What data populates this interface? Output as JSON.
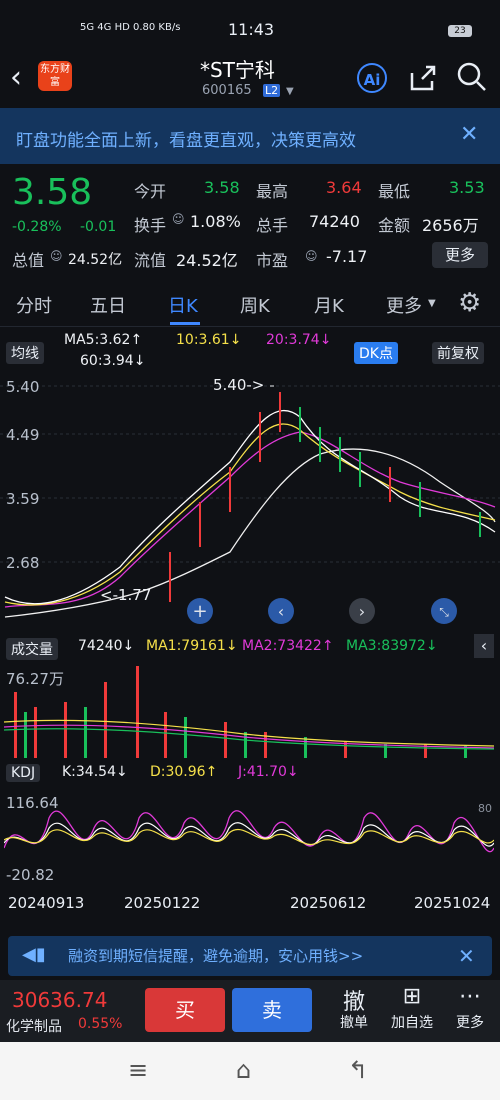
{
  "status_bar": {
    "signal": "5G 4G HD 0.80 KB/s",
    "time": "11:43",
    "battery": "23"
  },
  "header": {
    "logo": "东方财富",
    "title": "*ST宁科",
    "code": "600165",
    "level": "L2",
    "ai_label": "Ai"
  },
  "banner": {
    "text": "盯盘功能全面上新，看盘更直观，决策更高效"
  },
  "quote": {
    "price": "3.58",
    "change_pct": "-0.28%",
    "change": "-0.01",
    "open_label": "今开",
    "open": "3.58",
    "high_label": "最高",
    "high": "3.64",
    "low_label": "最低",
    "low": "3.53",
    "turnover_label": "换手",
    "turnover": "1.08%",
    "volume_label": "总手",
    "volume": "74240",
    "amount_label": "金额",
    "amount": "2656万",
    "mktcap_label": "总值",
    "mktcap": "24.52亿",
    "float_label": "流值",
    "float": "24.52亿",
    "pe_label": "市盈",
    "pe": "-7.17",
    "more": "更多"
  },
  "tabs": [
    "分时",
    "五日",
    "日K",
    "周K",
    "月K",
    "更多"
  ],
  "active_tab": "日K",
  "kline": {
    "ma_button": "均线",
    "ma5": "MA5:3.62↑",
    "ma10": "10:3.61↓",
    "ma20": "20:3.74↓",
    "ma60": "60:3.94↓",
    "dk": "DK点",
    "adjust": "前复权",
    "y_high": "5.40",
    "y_mid": "4.49",
    "y_low": "3.59",
    "y_bottom": "2.68",
    "max_marker": "5.40->",
    "min_marker": "<-1.77"
  },
  "volume": {
    "label": "成交量",
    "value": "74240↓",
    "ma1": "MA1:79161↓",
    "ma2": "MA2:73422↑",
    "ma3": "MA3:83972↓",
    "y_max": "76.27万"
  },
  "kdj": {
    "label": "KDJ",
    "k": "K:34.54↓",
    "d": "D:30.96↑",
    "j": "J:41.70↓",
    "y_max": "116.64",
    "y_min": "-20.82",
    "ref": "80"
  },
  "dates": [
    "20240913",
    "20250122",
    "20250612",
    "20251024"
  ],
  "notice": {
    "text": "融资到期短信提醒，避免逾期，安心用钱>>"
  },
  "bottom": {
    "index_value": "30636.74",
    "index_name": "化学制品",
    "index_change": "0.55%",
    "buy": "买",
    "sell": "卖",
    "cancel": "撤单",
    "add": "加自选",
    "more": "更多"
  },
  "colors": {
    "up": "#f03a3a",
    "down": "#19c05b",
    "accent": "#3f88ff",
    "ma5": "#ffffff",
    "ma10": "#f5e04a",
    "ma20": "#e03ad8"
  }
}
